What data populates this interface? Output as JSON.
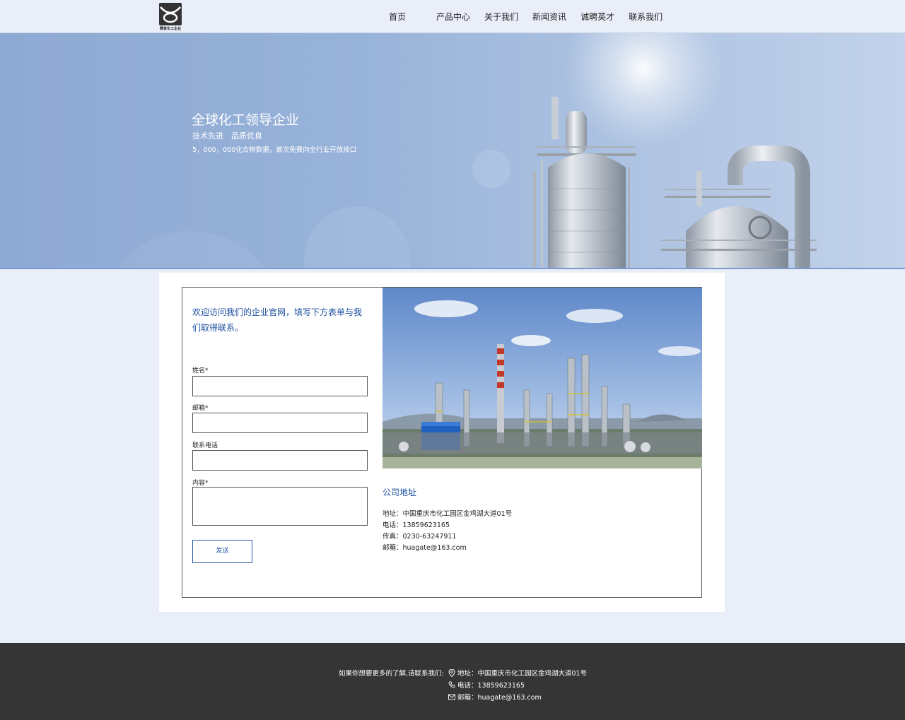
{
  "header": {
    "logo_text": "赛普化工企业",
    "nav": [
      "首页",
      "产品中心",
      "关于我们",
      "新闻资讯",
      "诚聘英才",
      "联系我们"
    ]
  },
  "hero": {
    "title": "全球化工领导企业",
    "subtitle": "技术先进　品质优良",
    "tagline": "5，000，000化合物数据，首次免费向全行业开放接口"
  },
  "form": {
    "welcome": "欢迎访问我们的企业官网，填写下方表单与我们取得联系。",
    "name_label": "姓名*",
    "email_label": "邮箱*",
    "phone_label": "联系电话",
    "content_label": "内容*",
    "name_value": "",
    "email_value": "",
    "phone_value": "",
    "content_value": "",
    "send_label": "发送"
  },
  "company": {
    "title": "公司地址",
    "address": "地址：中国重庆市化工园区金鸡湖大道01号",
    "phone": "电话：13859623165",
    "fax": "传真：0230-63247911",
    "email": "邮箱：huagate@163.com"
  },
  "footer": {
    "lead": "如果你想要更多的了解,请联系我们:",
    "address": "地址：中国重庆市化工园区金鸡湖大道01号",
    "phone": "电话：13859623165",
    "email": "邮箱：huagate@163.com"
  },
  "colors": {
    "accent": "#1d4fa0",
    "footer_bg": "#353535",
    "page_bg": "#e9eef8"
  }
}
